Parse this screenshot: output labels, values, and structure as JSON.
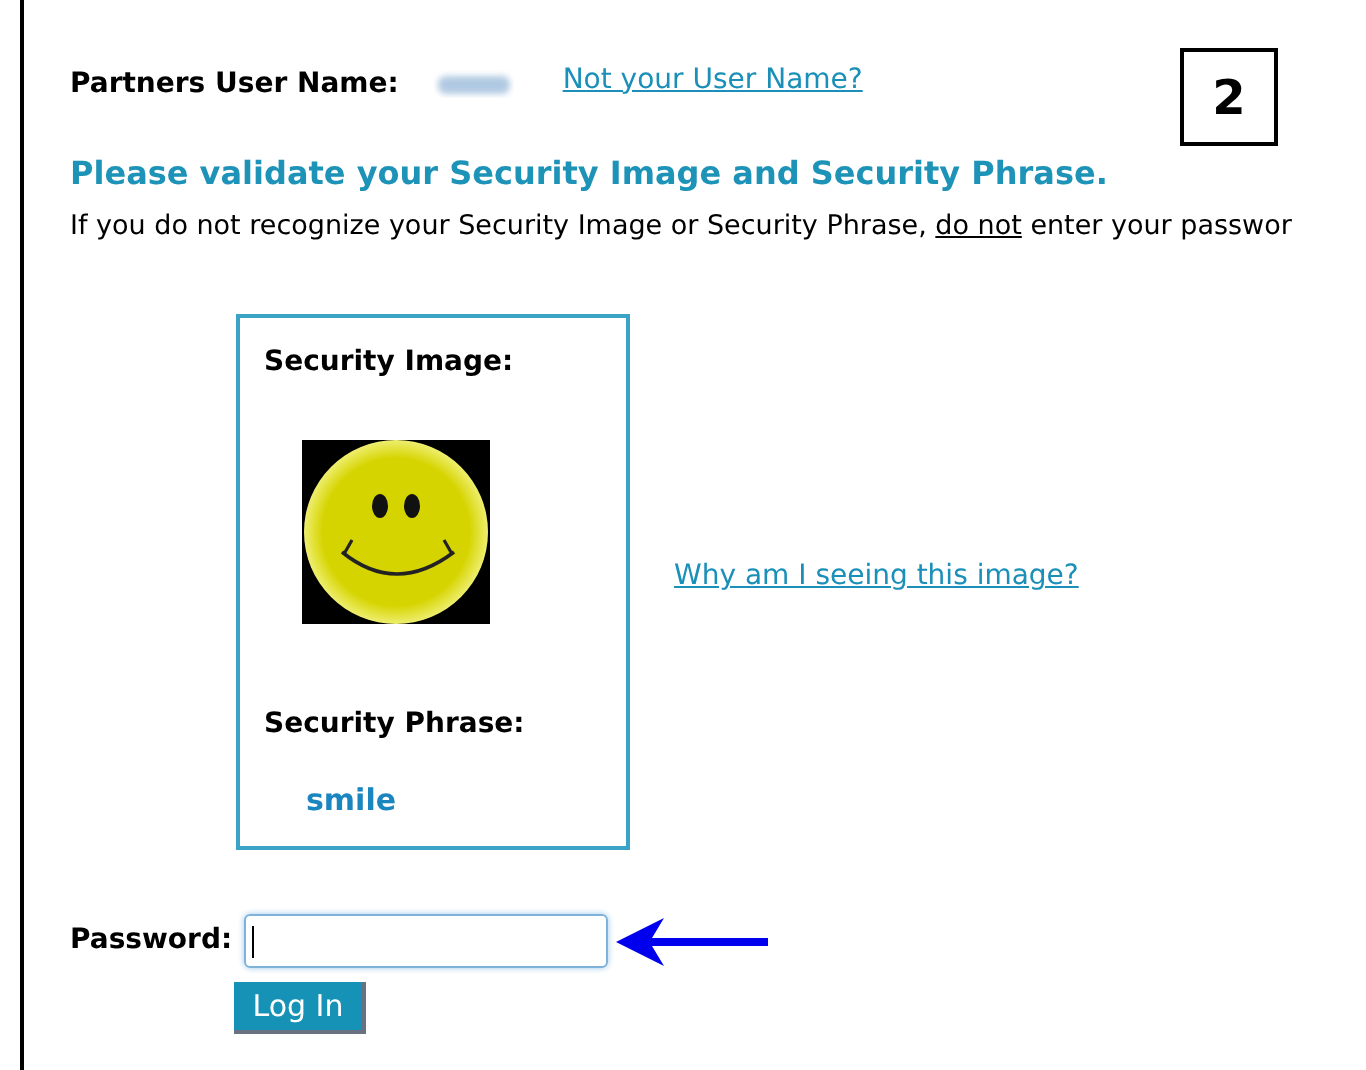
{
  "user_row": {
    "label": "Partners User Name:",
    "link": "Not your User Name?"
  },
  "step_number": "2",
  "heading": "Please validate your Security Image and Security Phrase.",
  "warning": {
    "before": "If you do not recognize your Security Image or Security Phrase, ",
    "underlined": "do not",
    "after": " enter your passwor"
  },
  "security_card": {
    "image_label": "Security Image:",
    "image": {
      "kind": "smiley"
    },
    "phrase_label": "Security Phrase:",
    "phrase": "smile"
  },
  "help_link": "Why am I seeing this image?",
  "password": {
    "label": "Password:",
    "focused": true
  },
  "login_button": "Log In"
}
